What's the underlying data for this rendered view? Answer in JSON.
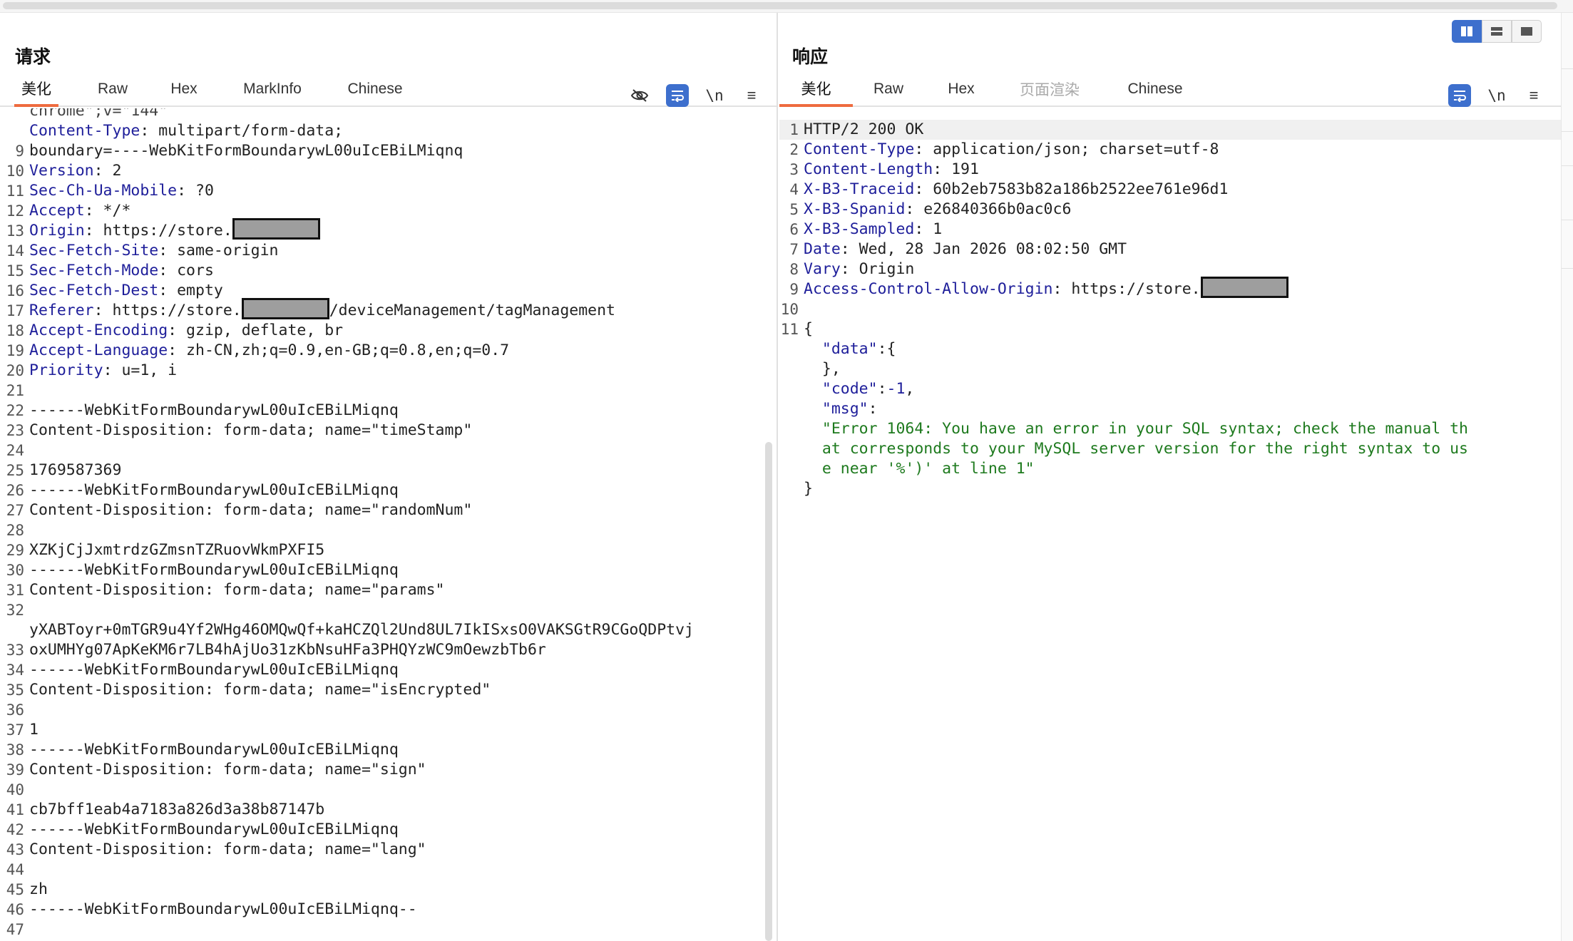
{
  "layout_toggle": {
    "options": [
      "split-horizontal",
      "split-vertical",
      "single"
    ],
    "active": "split-horizontal"
  },
  "request": {
    "title": "请求",
    "tabs": [
      "美化",
      "Raw",
      "Hex",
      "MarkInfo",
      "Chinese"
    ],
    "active_tab": "美化",
    "tools": {
      "hide": "eye-off-icon",
      "wrap": "wrap-icon",
      "newline": "\\n",
      "menu": "≡"
    },
    "top_partial": "chrome\";v=\"144\"",
    "lines": [
      {
        "n": "9",
        "key": "Content-Type",
        "val": "multipart/form-data;",
        "cont": "boundary=----WebKitFormBoundarywL00uIcEBiLMiqnq"
      },
      {
        "n": "10",
        "key": "Version",
        "val": "2"
      },
      {
        "n": "11",
        "key": "Sec-Ch-Ua-Mobile",
        "val": "?0"
      },
      {
        "n": "12",
        "key": "Accept",
        "val": "*/*"
      },
      {
        "n": "13",
        "key": "Origin",
        "val": "https://store.",
        "redact": true
      },
      {
        "n": "14",
        "key": "Sec-Fetch-Site",
        "val": "same-origin"
      },
      {
        "n": "15",
        "key": "Sec-Fetch-Mode",
        "val": "cors"
      },
      {
        "n": "16",
        "key": "Sec-Fetch-Dest",
        "val": "empty"
      },
      {
        "n": "17",
        "key": "Referer",
        "val": "https://store.",
        "redact": true,
        "after": "/deviceManagement/tagManagement"
      },
      {
        "n": "18",
        "key": "Accept-Encoding",
        "val": "gzip, deflate, br"
      },
      {
        "n": "19",
        "key": "Accept-Language",
        "val": "zh-CN,zh;q=0.9,en-GB;q=0.8,en;q=0.7"
      },
      {
        "n": "20",
        "key": "Priority",
        "val": "u=1, i"
      },
      {
        "n": "21",
        "text": ""
      },
      {
        "n": "22",
        "text": "------WebKitFormBoundarywL00uIcEBiLMiqnq"
      },
      {
        "n": "23",
        "text": "Content-Disposition: form-data; name=\"timeStamp\""
      },
      {
        "n": "24",
        "text": ""
      },
      {
        "n": "25",
        "text": "1769587369"
      },
      {
        "n": "26",
        "text": "------WebKitFormBoundarywL00uIcEBiLMiqnq"
      },
      {
        "n": "27",
        "text": "Content-Disposition: form-data; name=\"randomNum\""
      },
      {
        "n": "28",
        "text": ""
      },
      {
        "n": "29",
        "text": "XZKjCjJxmtrdzGZmsnTZRuovWkmPXFI5"
      },
      {
        "n": "30",
        "text": "------WebKitFormBoundarywL00uIcEBiLMiqnq"
      },
      {
        "n": "31",
        "text": "Content-Disposition: form-data; name=\"params\""
      },
      {
        "n": "32",
        "text": ""
      },
      {
        "n": "33",
        "text": "yXABToyr+0mTGR9u4Yf2WHg46OMQwQf+kaHCZQl2Und8UL7IkISxsO0VAKSGtR9CGoQDPtvj",
        "cont": "oxUMHYg07ApKeKM6r7LB4hAjUo31zKbNsuHFa3PHQYzWC9mOewzbTb6r"
      },
      {
        "n": "34",
        "text": "------WebKitFormBoundarywL00uIcEBiLMiqnq"
      },
      {
        "n": "35",
        "text": "Content-Disposition: form-data; name=\"isEncrypted\""
      },
      {
        "n": "36",
        "text": ""
      },
      {
        "n": "37",
        "text": "1"
      },
      {
        "n": "38",
        "text": "------WebKitFormBoundarywL00uIcEBiLMiqnq"
      },
      {
        "n": "39",
        "text": "Content-Disposition: form-data; name=\"sign\""
      },
      {
        "n": "40",
        "text": ""
      },
      {
        "n": "41",
        "text": "cb7bff1eab4a7183a826d3a38b87147b"
      },
      {
        "n": "42",
        "text": "------WebKitFormBoundarywL00uIcEBiLMiqnq"
      },
      {
        "n": "43",
        "text": "Content-Disposition: form-data; name=\"lang\""
      },
      {
        "n": "44",
        "text": ""
      },
      {
        "n": "45",
        "text": "zh"
      },
      {
        "n": "46",
        "text": "------WebKitFormBoundarywL00uIcEBiLMiqnq--"
      },
      {
        "n": "47",
        "text": ""
      }
    ]
  },
  "response": {
    "title": "响应",
    "tabs": [
      "美化",
      "Raw",
      "Hex",
      "页面渲染",
      "Chinese"
    ],
    "active_tab": "美化",
    "disabled_tab": "页面渲染",
    "tools": {
      "wrap": "wrap-icon",
      "newline": "\\n",
      "menu": "≡"
    },
    "lines": [
      {
        "n": "1",
        "text": "HTTP/2 200 OK",
        "hl": true
      },
      {
        "n": "2",
        "key": "Content-Type",
        "val": "application/json; charset=utf-8"
      },
      {
        "n": "3",
        "key": "Content-Length",
        "val": "191"
      },
      {
        "n": "4",
        "key": "X-B3-Traceid",
        "val": "60b2eb7583b82a186b2522ee761e96d1"
      },
      {
        "n": "5",
        "key": "X-B3-Spanid",
        "val": "e26840366b0ac0c6"
      },
      {
        "n": "6",
        "key": "X-B3-Sampled",
        "val": "1"
      },
      {
        "n": "7",
        "key": "Date",
        "val": "Wed, 28 Jan 2026 08:02:50 GMT"
      },
      {
        "n": "8",
        "key": "Vary",
        "val": "Origin"
      },
      {
        "n": "9",
        "key": "Access-Control-Allow-Origin",
        "val": "https://store.",
        "redact": true
      },
      {
        "n": "10",
        "text": ""
      }
    ],
    "json_body": {
      "n": "11",
      "open": "{",
      "data_key": "\"data\"",
      "data_open": ":{",
      "data_close": "},",
      "code_key": "\"code\"",
      "code_val": "-1",
      "msg_key": "\"msg\"",
      "msg_lines": [
        "\"Error 1064: You have an error in your SQL syntax; check the manual th",
        "at corresponds to your MySQL server version for the right syntax to us",
        "e near '%')' at line 1\""
      ],
      "close": "}"
    }
  }
}
